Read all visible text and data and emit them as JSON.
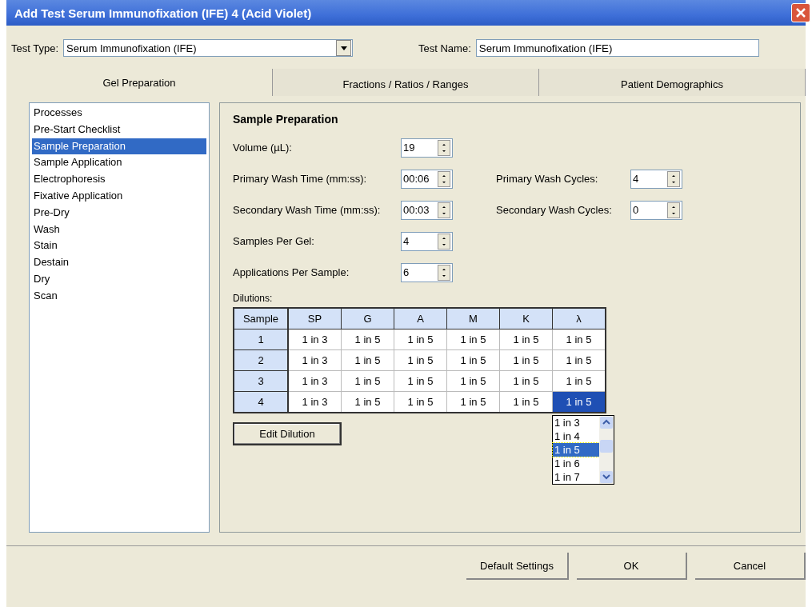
{
  "window": {
    "title": "Add Test Serum Immunofixation (IFE) 4 (Acid Violet)"
  },
  "test_type": {
    "label": "Test Type:",
    "value": "Serum Immunofixation (IFE)"
  },
  "test_name": {
    "label": "Test Name:",
    "value": "Serum Immunofixation (IFE)"
  },
  "tabs": [
    {
      "label": "Gel Preparation",
      "selected": true
    },
    {
      "label": "Fractions / Ratios / Ranges",
      "selected": false
    },
    {
      "label": "Patient Demographics",
      "selected": false
    }
  ],
  "sidebar": {
    "items": [
      {
        "label": "Processes",
        "selected": false
      },
      {
        "label": "Pre-Start Checklist",
        "selected": false
      },
      {
        "label": "Sample Preparation",
        "selected": true
      },
      {
        "label": "Sample Application",
        "selected": false
      },
      {
        "label": "Electrophoresis",
        "selected": false
      },
      {
        "label": "Fixative Application",
        "selected": false
      },
      {
        "label": "Pre-Dry",
        "selected": false
      },
      {
        "label": "Wash",
        "selected": false
      },
      {
        "label": "Stain",
        "selected": false
      },
      {
        "label": "Destain",
        "selected": false
      },
      {
        "label": "Dry",
        "selected": false
      },
      {
        "label": "Scan",
        "selected": false
      }
    ]
  },
  "section_title": "Sample Preparation",
  "fields": [
    [
      {
        "label": "Volume (µL):",
        "value": "19"
      }
    ],
    [
      {
        "label": "Primary Wash Time (mm:ss):",
        "value": "00:06"
      },
      {
        "label": "Primary Wash Cycles:",
        "value": "4"
      }
    ],
    [
      {
        "label": "Secondary Wash Time (mm:ss):",
        "value": "00:03"
      },
      {
        "label": "Secondary Wash Cycles:",
        "value": "0"
      }
    ],
    [
      {
        "label": "Samples Per Gel:",
        "value": "4"
      }
    ],
    [
      {
        "label": "Applications Per Sample:",
        "value": "6"
      }
    ]
  ],
  "dilutions": {
    "label": "Dilutions:",
    "columns": [
      "Sample",
      "SP",
      "G",
      "A",
      "M",
      "K",
      "λ"
    ],
    "rows": [
      {
        "cells": [
          {
            "text": "1",
            "selected": false
          },
          {
            "text": "1 in 3",
            "selected": false
          },
          {
            "text": "1 in 5",
            "selected": false
          },
          {
            "text": "1 in 5",
            "selected": false
          },
          {
            "text": "1 in 5",
            "selected": false
          },
          {
            "text": "1 in 5",
            "selected": false
          },
          {
            "text": "1 in 5",
            "selected": false
          }
        ]
      },
      {
        "cells": [
          {
            "text": "2",
            "selected": false
          },
          {
            "text": "1 in 3",
            "selected": false
          },
          {
            "text": "1 in 5",
            "selected": false
          },
          {
            "text": "1 in 5",
            "selected": false
          },
          {
            "text": "1 in 5",
            "selected": false
          },
          {
            "text": "1 in 5",
            "selected": false
          },
          {
            "text": "1 in 5",
            "selected": false
          }
        ]
      },
      {
        "cells": [
          {
            "text": "3",
            "selected": false
          },
          {
            "text": "1 in 3",
            "selected": false
          },
          {
            "text": "1 in 5",
            "selected": false
          },
          {
            "text": "1 in 5",
            "selected": false
          },
          {
            "text": "1 in 5",
            "selected": false
          },
          {
            "text": "1 in 5",
            "selected": false
          },
          {
            "text": "1 in 5",
            "selected": false
          }
        ]
      },
      {
        "cells": [
          {
            "text": "4",
            "selected": false
          },
          {
            "text": "1 in 3",
            "selected": false
          },
          {
            "text": "1 in 5",
            "selected": false
          },
          {
            "text": "1 in 5",
            "selected": false
          },
          {
            "text": "1 in 5",
            "selected": false
          },
          {
            "text": "1 in 5",
            "selected": false
          },
          {
            "text": "1 in 5",
            "selected": true
          }
        ]
      }
    ],
    "dropdown": [
      {
        "label": "1 in 3",
        "selected": false
      },
      {
        "label": "1 in 4",
        "selected": false
      },
      {
        "label": "1 in 5",
        "selected": true
      },
      {
        "label": "1 in 6",
        "selected": false
      },
      {
        "label": "1 in 7",
        "selected": false
      }
    ]
  },
  "edit_button": "Edit Dilution",
  "buttons": [
    "Default Settings",
    "OK",
    "Cancel"
  ]
}
